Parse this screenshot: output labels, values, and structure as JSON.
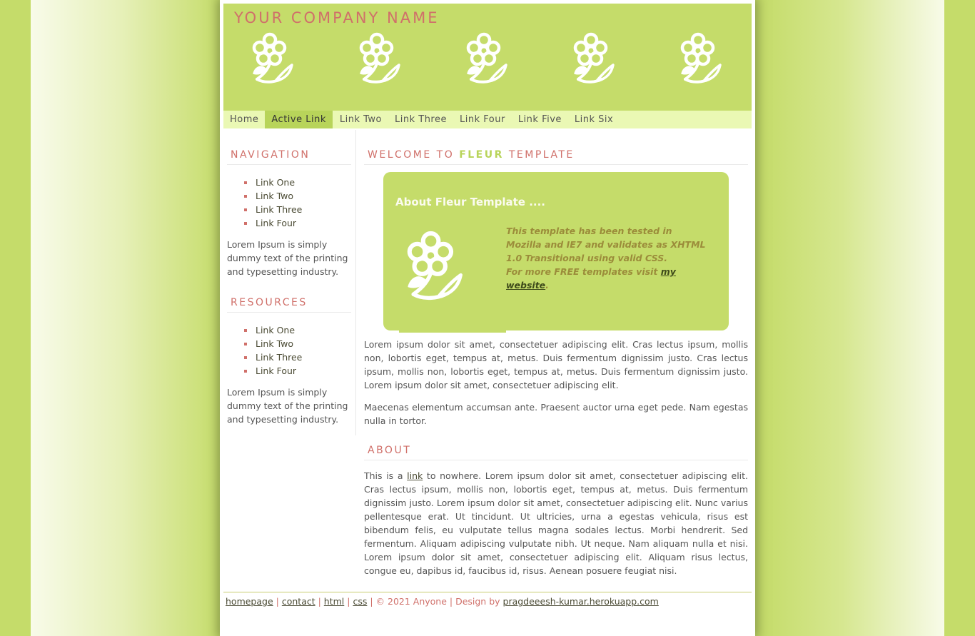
{
  "header": {
    "company_name": "YOUR COMPANY NAME"
  },
  "menu": [
    {
      "label": "Home",
      "active": false
    },
    {
      "label": "Active Link",
      "active": true
    },
    {
      "label": "Link Two",
      "active": false
    },
    {
      "label": "Link Three",
      "active": false
    },
    {
      "label": "Link Four",
      "active": false
    },
    {
      "label": "Link Five",
      "active": false
    },
    {
      "label": "Link Six",
      "active": false
    }
  ],
  "sidebar": {
    "navigation_title": "NAVIGATION",
    "navigation_links": [
      "Link One",
      "Link Two",
      "Link Three",
      "Link Four"
    ],
    "navigation_text": "Lorem Ipsum is simply dummy text of the printing and typesetting industry.",
    "resources_title": "RESOURCES",
    "resources_links": [
      "Link One",
      "Link Two",
      "Link Three",
      "Link Four"
    ],
    "resources_text": "Lorem Ipsum is simply dummy text of the printing and typesetting industry."
  },
  "main": {
    "welcome_prefix": "WELCOME TO ",
    "welcome_highlight": "FLEUR",
    "welcome_suffix": " TEMPLATE",
    "box_title": "About Fleur Template ....",
    "box_text_1": "This template has been tested in Mozilla and IE7 and validates as XHTML 1.0 Transitional using valid CSS.",
    "box_text_2": "For more FREE templates visit ",
    "box_link": "my website",
    "box_text_end": ".",
    "para1": "Lorem ipsum dolor sit amet, consectetuer adipiscing elit. Cras lectus ipsum, mollis non, lobortis eget, tempus at, metus. Duis fermentum dignissim justo. Cras lectus ipsum, mollis non, lobortis eget, tempus at, metus. Duis fermentum dignissim justo. Lorem ipsum dolor sit amet, consectetuer adipiscing elit.",
    "para2": "Maecenas elementum accumsan ante. Praesent auctor urna eget pede. Nam egestas nulla in tortor.",
    "about_title": "ABOUT",
    "about_prefix": "This is a ",
    "about_link": "link",
    "about_rest": " to nowhere. Lorem ipsum dolor sit amet, consectetuer adipiscing elit. Cras lectus ipsum, mollis non, lobortis eget, tempus at, metus. Duis fermentum dignissim justo. Lorem ipsum dolor sit amet, consectetuer adipiscing elit. Nunc varius pellentesque erat. Ut tincidunt. Ut ultricies, urna a egestas vehicula, risus est bibendum felis, eu vulputate tellus magna sodales lectus. Morbi hendrerit. Sed fermentum. Aliquam adipiscing vulputate nibh. Ut neque. Nam aliquam nulla et nisi. Lorem ipsum dolor sit amet, consectetuer adipiscing elit. Aliquam risus lectus, congue eu, dapibus id, faucibus id, risus. Aenean posuere feugiat nisi."
  },
  "footer": {
    "links": [
      "homepage",
      "contact",
      "html",
      "css"
    ],
    "separator": " | ",
    "copyright": " | © 2021 Anyone | Design by ",
    "design_link": "pragdeeesh-kumar.herokuapp.com"
  },
  "colors": {
    "accent_green": "#c5dc6a",
    "heading_pink": "#d0706a",
    "menu_bg": "#eaf8b4",
    "active_link_bg": "#b8d45a"
  }
}
